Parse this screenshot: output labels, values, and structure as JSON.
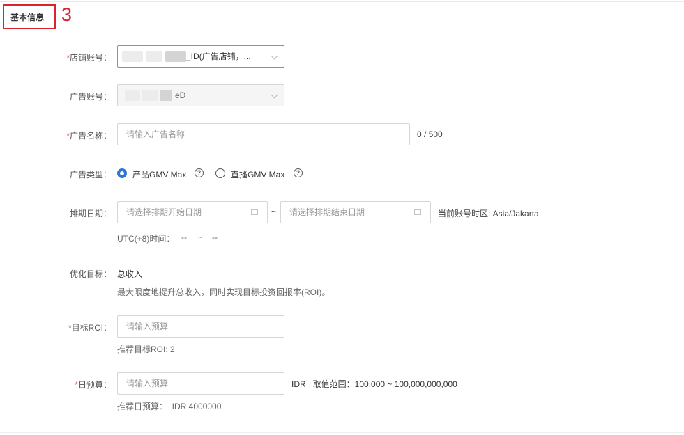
{
  "section": {
    "title": "基本信息",
    "annotation_number": "3",
    "annotation_color": "#d9232d"
  },
  "required_mark": "*",
  "shop_account": {
    "label": "店铺账号：",
    "value": "_ID(广告店铺，..."
  },
  "ad_account": {
    "label": "广告账号：",
    "value": "eD"
  },
  "ad_name": {
    "label": "广告名称：",
    "placeholder": "请输入广告名称",
    "counter": "0 / 500"
  },
  "ad_type": {
    "label": "广告类型：",
    "options": [
      {
        "label": "产品GMV Max",
        "selected": true
      },
      {
        "label": "直播GMV Max",
        "selected": false
      }
    ],
    "help_glyph": "?"
  },
  "schedule": {
    "label": "排期日期：",
    "start_placeholder": "请选择排期开始日期",
    "separator": "~",
    "end_placeholder": "请选择排期结束日期",
    "timezone_note": "当前账号时区: Asia/Jakarta",
    "utc_label": "UTC(+8)时间：",
    "utc_start": "--",
    "utc_sep": "~",
    "utc_end": "--"
  },
  "goal": {
    "label": "优化目标：",
    "value": "总收入",
    "description": "最大限度地提升总收入，同时实现目标投资回报率(ROI)。"
  },
  "target_roi": {
    "label": "目标ROI：",
    "placeholder": "请输入预算",
    "recommend": "推荐目标ROI: 2"
  },
  "daily_budget": {
    "label": "日预算：",
    "placeholder": "请输入预算",
    "currency_range": "IDR   取值范围：100,000 ~ 100,000,000,000",
    "recommend": "推荐日预算：  IDR 4000000"
  },
  "colors": {
    "accent": "#2b78d4",
    "required": "#e83a3a"
  }
}
